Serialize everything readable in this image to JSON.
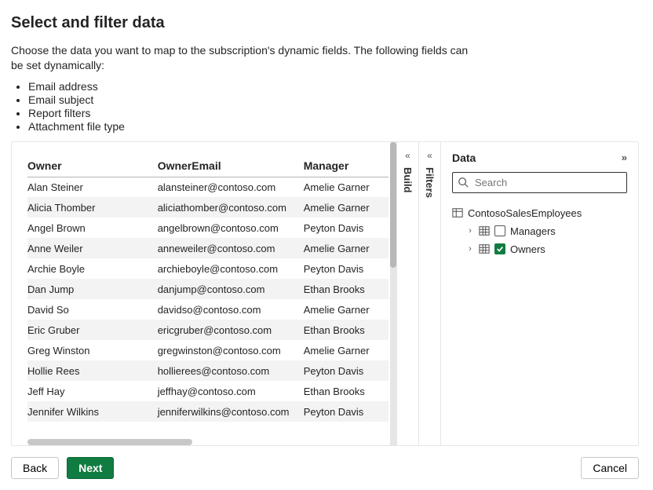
{
  "title": "Select and filter data",
  "intro": "Choose the data you want to map to the subscription's dynamic fields. The following fields can be set dynamically:",
  "dynamic_fields": [
    "Email address",
    "Email subject",
    "Report filters",
    "Attachment file type"
  ],
  "table": {
    "columns": [
      "Owner",
      "OwnerEmail",
      "Manager"
    ],
    "rows": [
      {
        "owner": "Alan Steiner",
        "email": "alansteiner@contoso.com",
        "manager": "Amelie Garner"
      },
      {
        "owner": "Alicia Thomber",
        "email": "aliciathomber@contoso.com",
        "manager": "Amelie Garner"
      },
      {
        "owner": "Angel Brown",
        "email": "angelbrown@contoso.com",
        "manager": "Peyton Davis"
      },
      {
        "owner": "Anne Weiler",
        "email": "anneweiler@contoso.com",
        "manager": "Amelie Garner"
      },
      {
        "owner": "Archie Boyle",
        "email": "archieboyle@contoso.com",
        "manager": "Peyton Davis"
      },
      {
        "owner": "Dan Jump",
        "email": "danjump@contoso.com",
        "manager": "Ethan Brooks"
      },
      {
        "owner": "David So",
        "email": "davidso@contoso.com",
        "manager": "Amelie Garner"
      },
      {
        "owner": "Eric Gruber",
        "email": "ericgruber@contoso.com",
        "manager": "Ethan Brooks"
      },
      {
        "owner": "Greg Winston",
        "email": "gregwinston@contoso.com",
        "manager": "Amelie Garner"
      },
      {
        "owner": "Hollie Rees",
        "email": "hollierees@contoso.com",
        "manager": "Peyton Davis"
      },
      {
        "owner": "Jeff Hay",
        "email": "jeffhay@contoso.com",
        "manager": "Ethan Brooks"
      },
      {
        "owner": "Jennifer Wilkins",
        "email": "jenniferwilkins@contoso.com",
        "manager": "Peyton Davis"
      }
    ]
  },
  "rails": {
    "build": "Build",
    "filters": "Filters"
  },
  "data_panel": {
    "heading": "Data",
    "search_placeholder": "Search",
    "dataset": "ContosoSalesEmployees",
    "tables": [
      {
        "name": "Managers",
        "checked": false
      },
      {
        "name": "Owners",
        "checked": true
      }
    ]
  },
  "buttons": {
    "back": "Back",
    "next": "Next",
    "cancel": "Cancel"
  }
}
